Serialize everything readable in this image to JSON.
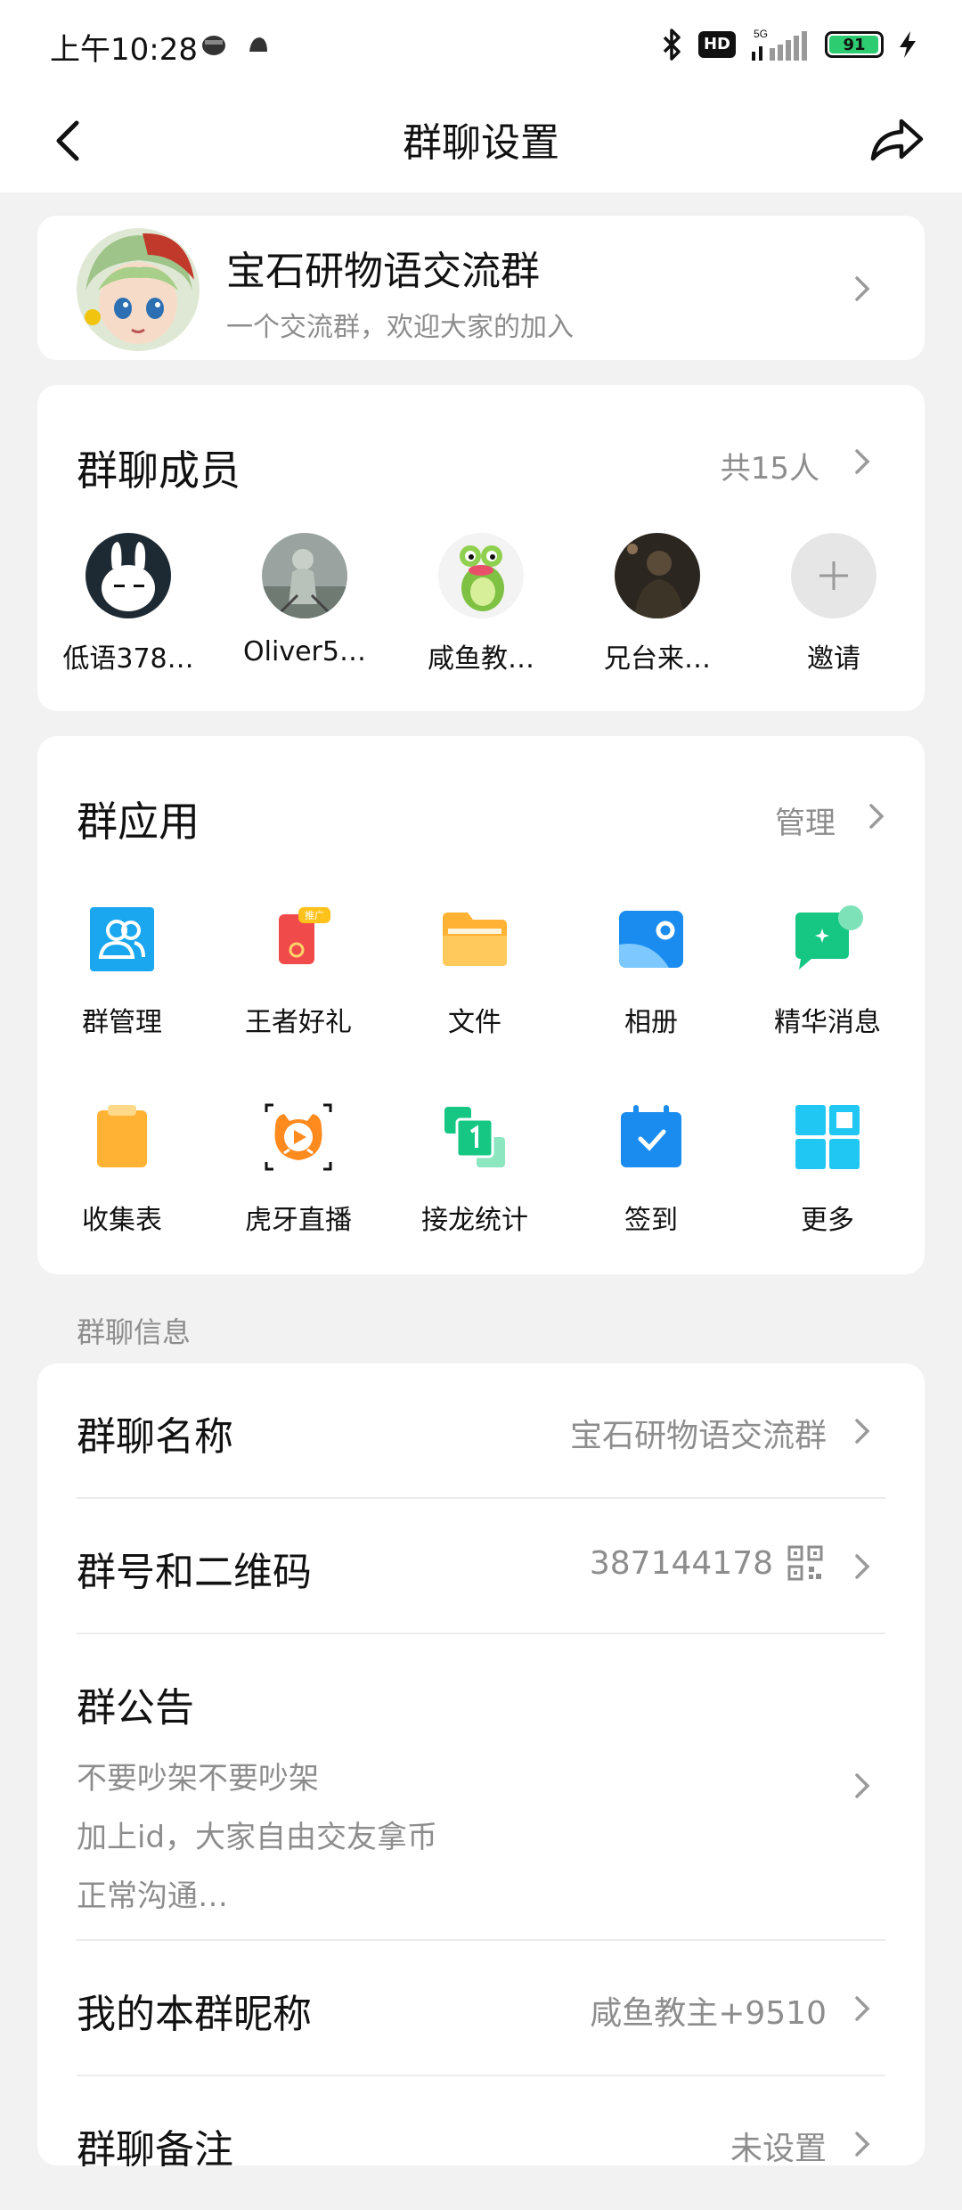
{
  "status_bar": {
    "time": "上午10:28",
    "hd_label": "HD",
    "network": "5G",
    "battery": "91",
    "battery_level": 0.91
  },
  "nav": {
    "title": "群聊设置",
    "back_icon": "back-arrow-icon",
    "share_icon": "share-icon"
  },
  "group": {
    "name": "宝石研物语交流群",
    "description": "一个交流群，欢迎大家的加入"
  },
  "members": {
    "title": "群聊成员",
    "count": "共15人",
    "list": [
      {
        "name": "低语378…"
      },
      {
        "name": "Oliver5…"
      },
      {
        "name": "咸鱼教…"
      },
      {
        "name": "兄台来…"
      },
      {
        "name": "邀请"
      }
    ]
  },
  "apps": {
    "title": "群应用",
    "manage": "管理",
    "badge": "推广",
    "row1": [
      {
        "label": "群管理",
        "icon": "group-manage-icon"
      },
      {
        "label": "王者好礼",
        "icon": "gift-icon"
      },
      {
        "label": "文件",
        "icon": "folder-icon"
      },
      {
        "label": "相册",
        "icon": "album-icon"
      },
      {
        "label": "精华消息",
        "icon": "featured-message-icon"
      }
    ],
    "row2": [
      {
        "label": "收集表",
        "icon": "clipboard-icon"
      },
      {
        "label": "虎牙直播",
        "icon": "huya-live-icon"
      },
      {
        "label": "接龙统计",
        "icon": "relay-count-icon"
      },
      {
        "label": "签到",
        "icon": "checkin-calendar-icon"
      },
      {
        "label": "更多",
        "icon": "more-grid-icon"
      }
    ]
  },
  "info": {
    "header": "群聊信息",
    "name_label": "群聊名称",
    "name_value": "宝石研物语交流群",
    "number_label": "群号和二维码",
    "number_value": "387144178",
    "announcement_label": "群公告",
    "announcement_lines": [
      "不要吵架不要吵架",
      "加上id，大家自由交友拿币",
      "正常沟通…"
    ],
    "nickname_label": "我的本群昵称",
    "nickname_value": "咸鱼教主+9510",
    "remark_label": "群聊备注",
    "remark_value": "未设置"
  },
  "colors": {
    "background": "#f2f2f2",
    "card": "#ffffff",
    "text": "#111111",
    "secondary_text": "#8d8d8d",
    "app_blue": "#1aa7f0",
    "app_green": "#16c784",
    "app_orange": "#ffb233"
  }
}
